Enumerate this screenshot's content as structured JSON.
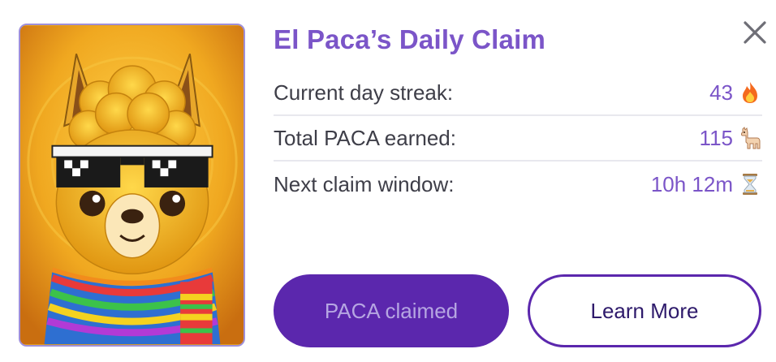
{
  "dialog": {
    "title": "El Paca’s Daily Claim",
    "close_icon": "close-icon",
    "image_icon": "alpaca-portrait-image"
  },
  "stats": [
    {
      "label": "Current day streak:",
      "value": "43",
      "icon": "fire-emoji-icon"
    },
    {
      "label": "Total PACA earned:",
      "value": "115",
      "icon": "llama-emoji-icon"
    },
    {
      "label": "Next claim window:",
      "value": "10h 12m",
      "icon": "hourglass-emoji-icon"
    }
  ],
  "buttons": {
    "claimed_label": "PACA claimed",
    "learn_more_label": "Learn More"
  },
  "colors": {
    "accent": "#7b55c8",
    "button_primary": "#5b27ad",
    "text": "#3e3e48"
  }
}
